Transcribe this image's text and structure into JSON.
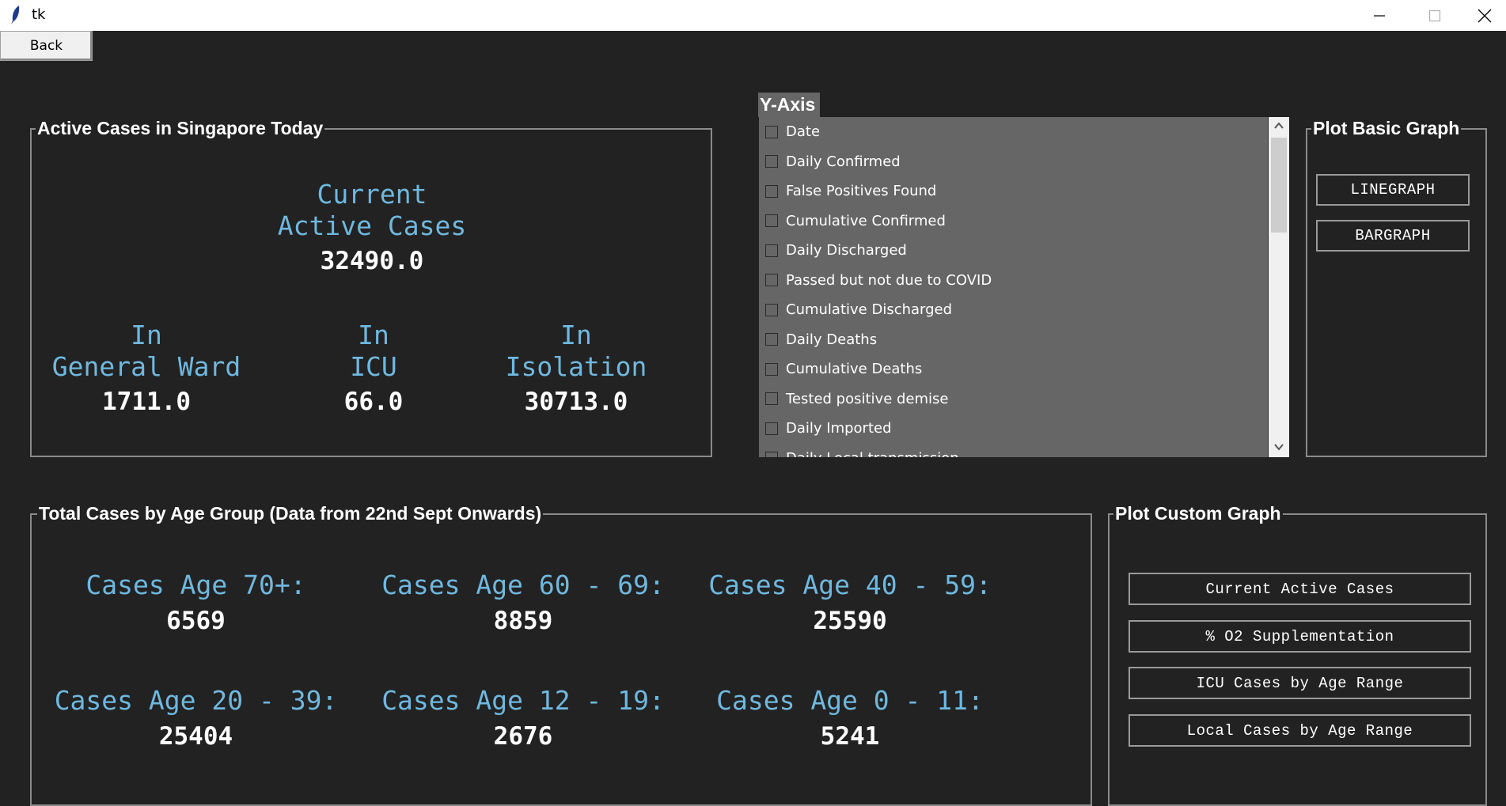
{
  "window": {
    "title": "tk"
  },
  "back_label": "Back",
  "active_panel": {
    "title": "Active Cases in Singapore Today",
    "current_label_1": "Current",
    "current_label_2": "Active Cases",
    "current_value": "32490.0",
    "general_ward_label_1": "In",
    "general_ward_label_2": "General Ward",
    "general_ward_value": "1711.0",
    "icu_label_1": "In",
    "icu_label_2": "ICU",
    "icu_value": "66.0",
    "isolation_label_1": "In",
    "isolation_label_2": "Isolation",
    "isolation_value": "30713.0"
  },
  "yaxis": {
    "title": "Y-Axis",
    "items": [
      "Date",
      "Daily Confirmed",
      "False Positives Found",
      "Cumulative Confirmed",
      "Daily Discharged",
      "Passed but not due to COVID",
      "Cumulative Discharged",
      "Daily Deaths",
      "Cumulative Deaths",
      "Tested positive demise",
      "Daily Imported",
      "Daily Local transmission"
    ]
  },
  "basic_graph": {
    "title": "Plot Basic Graph",
    "line_label": "LINEGRAPH",
    "bar_label": "BARGRAPH"
  },
  "age_panel": {
    "title": "Total Cases by Age Group (Data from 22nd Sept Onwards)",
    "age70_label": "Cases Age 70+:",
    "age70_value": "6569",
    "age60_label": "Cases Age 60 - 69:",
    "age60_value": "8859",
    "age40_label": "Cases Age 40 - 59:",
    "age40_value": "25590",
    "age20_label": "Cases Age 20 - 39:",
    "age20_value": "25404",
    "age12_label": "Cases Age 12 - 19:",
    "age12_value": "2676",
    "age0_label": "Cases Age 0 - 11:",
    "age0_value": "5241"
  },
  "custom_graph": {
    "title": "Plot Custom Graph",
    "btn1": "Current Active Cases",
    "btn2": "% O2 Supplementation",
    "btn3": "ICU Cases by Age Range",
    "btn4": "Local Cases by Age Range"
  }
}
